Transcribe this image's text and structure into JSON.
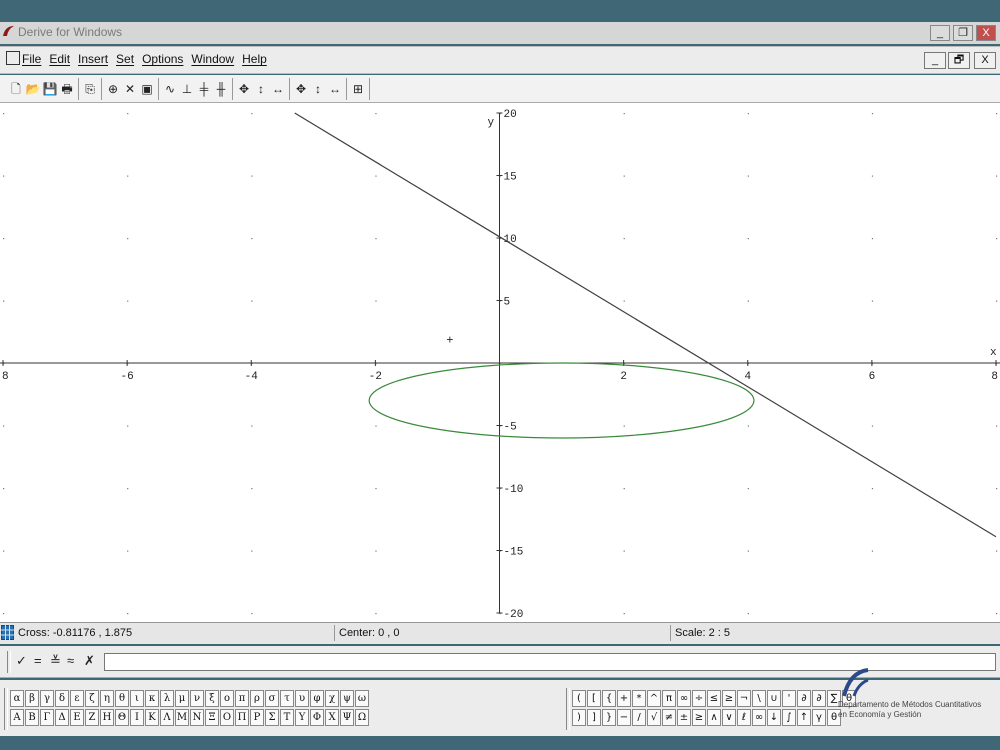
{
  "window": {
    "title": "Derive for Windows",
    "buttons": {
      "minimize": "_",
      "restore": "❐",
      "close": "X"
    }
  },
  "menu": {
    "items": [
      "File",
      "Edit",
      "Insert",
      "Set",
      "Options",
      "Window",
      "Help"
    ],
    "mdi_buttons": {
      "minimize": "_",
      "restore": "🗗",
      "close": "X"
    }
  },
  "toolbar": {
    "groups": [
      [
        "🗋",
        "📂",
        "💾",
        "🖶"
      ],
      [
        "⎘"
      ],
      [
        "⊕",
        "✕",
        "▣"
      ],
      [
        "∿",
        "⊥",
        "╪",
        "╫"
      ],
      [
        "✥",
        "↕",
        "↔"
      ],
      [
        "✥",
        "↕",
        "↔"
      ],
      [
        "⊞"
      ]
    ]
  },
  "plot": {
    "x_axis_label": "x",
    "y_axis_label": "y",
    "cross_marker": "+"
  },
  "chart_data": {
    "type": "line",
    "xlim": [
      -8,
      8
    ],
    "ylim": [
      -20,
      20
    ],
    "x_ticks": [
      -8,
      -6,
      -4,
      -2,
      2,
      4,
      6,
      8
    ],
    "x_tick_labels": [
      "8",
      "-6",
      "-4",
      "-2",
      "2",
      "4",
      "6",
      "8"
    ],
    "y_ticks": [
      20,
      15,
      10,
      5,
      -5,
      -10,
      -15,
      -20
    ],
    "y_tick_labels": [
      "20",
      "15",
      "10",
      "5",
      "-5",
      "-10",
      "-15",
      "-20"
    ],
    "grid": "dots",
    "series": [
      {
        "kind": "line",
        "color": "#404040",
        "points": [
          [
            -3.3,
            20
          ],
          [
            8,
            -13.9
          ]
        ]
      },
      {
        "kind": "ellipse",
        "color": "#3a8a3a",
        "center": [
          1,
          -3
        ],
        "rx": 3.1,
        "ry": 3
      }
    ],
    "cross": [
      -0.8,
      1.9
    ]
  },
  "status": {
    "cross": "Cross: -0.81176 , 1.875",
    "center": "Center: 0 , 0",
    "scale": "Scale: 2 : 5"
  },
  "input_bar": {
    "buttons": [
      "✓",
      "=",
      "≚",
      "≈",
      "✗"
    ],
    "expression_value": ""
  },
  "palettes": {
    "greek_lower": [
      "α",
      "β",
      "γ",
      "δ",
      "ε",
      "ζ",
      "η",
      "θ",
      "ι",
      "κ",
      "λ",
      "μ",
      "ν",
      "ξ",
      "ο",
      "π",
      "ρ",
      "σ",
      "τ",
      "υ",
      "φ",
      "χ",
      "ψ",
      "ω"
    ],
    "greek_upper": [
      "Α",
      "Β",
      "Γ",
      "Δ",
      "Ε",
      "Ζ",
      "Η",
      "Θ",
      "Ι",
      "Κ",
      "Λ",
      "Μ",
      "Ν",
      "Ξ",
      "Ο",
      "Π",
      "Ρ",
      "Σ",
      "Τ",
      "Υ",
      "Φ",
      "Χ",
      "Ψ",
      "Ω"
    ],
    "ops_row1": [
      "(",
      "[",
      "{",
      "+",
      "*",
      "^",
      "π",
      "∞",
      "÷",
      "≤",
      "≥",
      "¬",
      "\\",
      "∪",
      "'",
      "∂",
      "∂",
      "∑",
      "θ"
    ],
    "ops_row2": [
      ")",
      "]",
      "}",
      "−",
      "/",
      "√",
      "≠",
      "±",
      "≥",
      "∧",
      "∨",
      "ℓ",
      "∞",
      "↓",
      "∫",
      "↑",
      "γ",
      "θ"
    ]
  },
  "logo": {
    "line1": "Departamento de Métodos Cuantitativos",
    "line2": "en Economía y Gestión"
  }
}
